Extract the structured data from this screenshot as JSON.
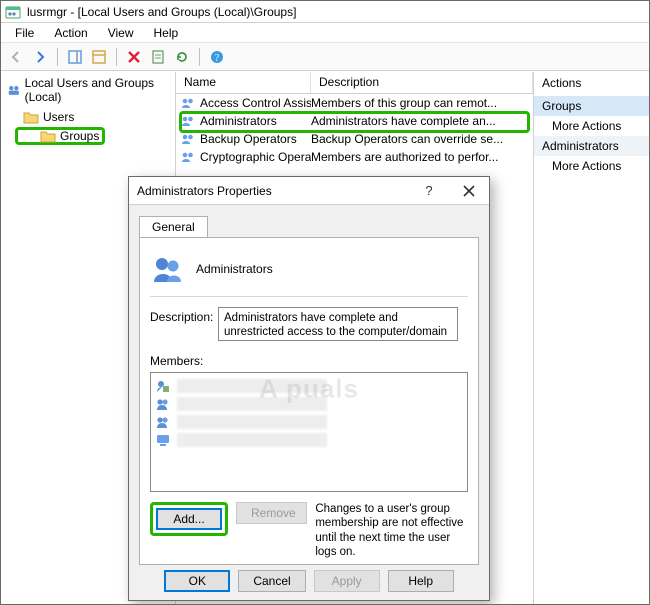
{
  "window": {
    "title": "lusrmgr - [Local Users and Groups (Local)\\Groups]"
  },
  "menu": {
    "file": "File",
    "action": "Action",
    "view": "View",
    "help": "Help"
  },
  "tree": {
    "root": "Local Users and Groups (Local)",
    "users": "Users",
    "groups": "Groups"
  },
  "list": {
    "columns": {
      "name": "Name",
      "description": "Description"
    },
    "rows": [
      {
        "name": "Access Control Assist...",
        "desc": "Members of this group can remot..."
      },
      {
        "name": "Administrators",
        "desc": "Administrators have complete an..."
      },
      {
        "name": "Backup Operators",
        "desc": "Backup Operators can override se..."
      },
      {
        "name": "Cryptographic Operat",
        "desc": "Members are authorized to perfor..."
      }
    ]
  },
  "actions": {
    "title": "Actions",
    "heading1": "Groups",
    "more1": "More Actions",
    "heading2": "Administrators",
    "more2": "More Actions"
  },
  "dialog": {
    "title": "Administrators Properties",
    "tab_general": "General",
    "group_name": "Administrators",
    "desc_label": "Description:",
    "desc_value": "Administrators have complete and unrestricted access to the computer/domain",
    "members_label": "Members:",
    "add": "Add...",
    "remove": "Remove",
    "note": "Changes to a user's group membership are not effective until the next time the user logs on.",
    "ok": "OK",
    "cancel": "Cancel",
    "apply": "Apply",
    "help": "Help"
  },
  "watermark": "A  puals"
}
